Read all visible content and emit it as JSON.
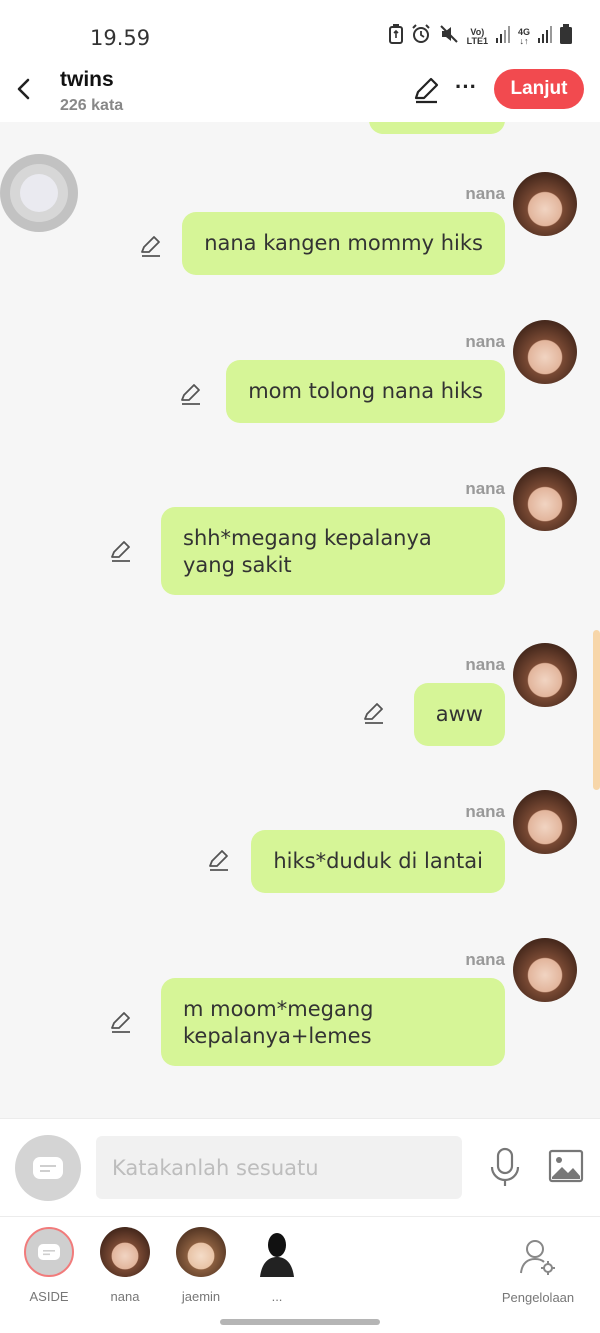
{
  "status_bar": {
    "time": "19.59",
    "network_label_1": "Vo)",
    "network_label_2": "LTE1",
    "network_label_3": "4G"
  },
  "header": {
    "title": "twins",
    "word_count": "226 kata",
    "next_label": "Lanjut"
  },
  "messages": [
    {
      "sender": "nana",
      "text": "nana kangen mommy hiks"
    },
    {
      "sender": "nana",
      "text": "mom tolong nana hiks"
    },
    {
      "sender": "nana",
      "text": "shh*megang kepalanya yang sakit"
    },
    {
      "sender": "nana",
      "text": "aww"
    },
    {
      "sender": "nana",
      "text": "hiks*duduk di lantai"
    },
    {
      "sender": "nana",
      "text": "m moom*megang kepalanya+lemes"
    }
  ],
  "composer": {
    "placeholder": "Katakanlah sesuatu"
  },
  "characters": [
    {
      "name": "ASIDE"
    },
    {
      "name": "nana"
    },
    {
      "name": "jaemin"
    },
    {
      "name": "..."
    }
  ],
  "manage_label": "Pengelolaan",
  "colors": {
    "accent": "#f24a4f",
    "bubble": "#d6f597",
    "background": "#f6f6f6"
  }
}
